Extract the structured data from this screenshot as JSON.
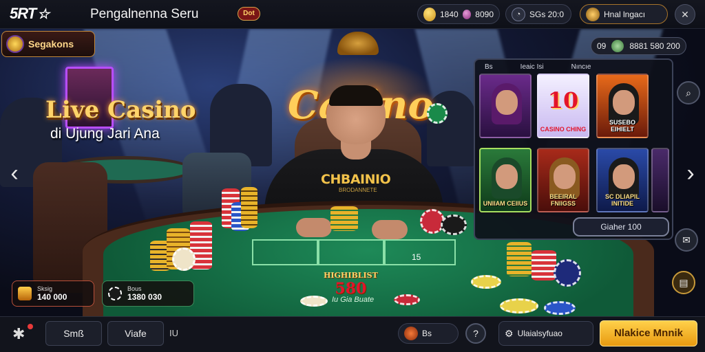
{
  "header": {
    "logo": "5RT",
    "title": "Pengalnenna Seru",
    "hot_badge": "Dot",
    "balance_coins": "1840",
    "balance_gems": "8090",
    "timer": "SGs 20:0",
    "user_label": "Hnal lngacı",
    "close_icon": "close-icon"
  },
  "promo_badge": "Segakons",
  "hero": {
    "headline": "Live Casino",
    "subline": "di Ujung Jari Ana",
    "neon_sign": "Casino"
  },
  "dealer": {
    "shirt_text": "CHBAINIO",
    "shirt_sub": "BRODANNETE"
  },
  "table": {
    "logo_text": "580",
    "logo_top": "HIGHIBLIST",
    "label": "Iu Gia Buate",
    "number": "15"
  },
  "panel": {
    "header": [
      "Bs",
      "Ieaic Isi",
      "Nıncıe"
    ],
    "tiles": [
      {
        "label": ""
      },
      {
        "label": "CASINO CHING",
        "big": "10"
      },
      {
        "label": "SUSEBO EIHIELT"
      },
      {
        "label": "UNIIAM CEIIUS"
      },
      {
        "label": "BEEIRAL FNIIGSS"
      },
      {
        "label": "SC DLIAPIL INITIDE"
      }
    ],
    "button": "Giaher 100"
  },
  "float_pill": {
    "code": "09",
    "value": "8881 580 200"
  },
  "stat_cards": [
    {
      "label": "Sksig",
      "value": "140 000"
    },
    {
      "label": "Bous",
      "value": "1380 030"
    }
  ],
  "bottom": {
    "btn1": "Smß",
    "btn2": "Viafe",
    "btn2_suffix": "IU",
    "coin_label": "Bs",
    "lobby_label": "Ulaialsyfuao",
    "cta": "Nlakice Mnnik"
  }
}
